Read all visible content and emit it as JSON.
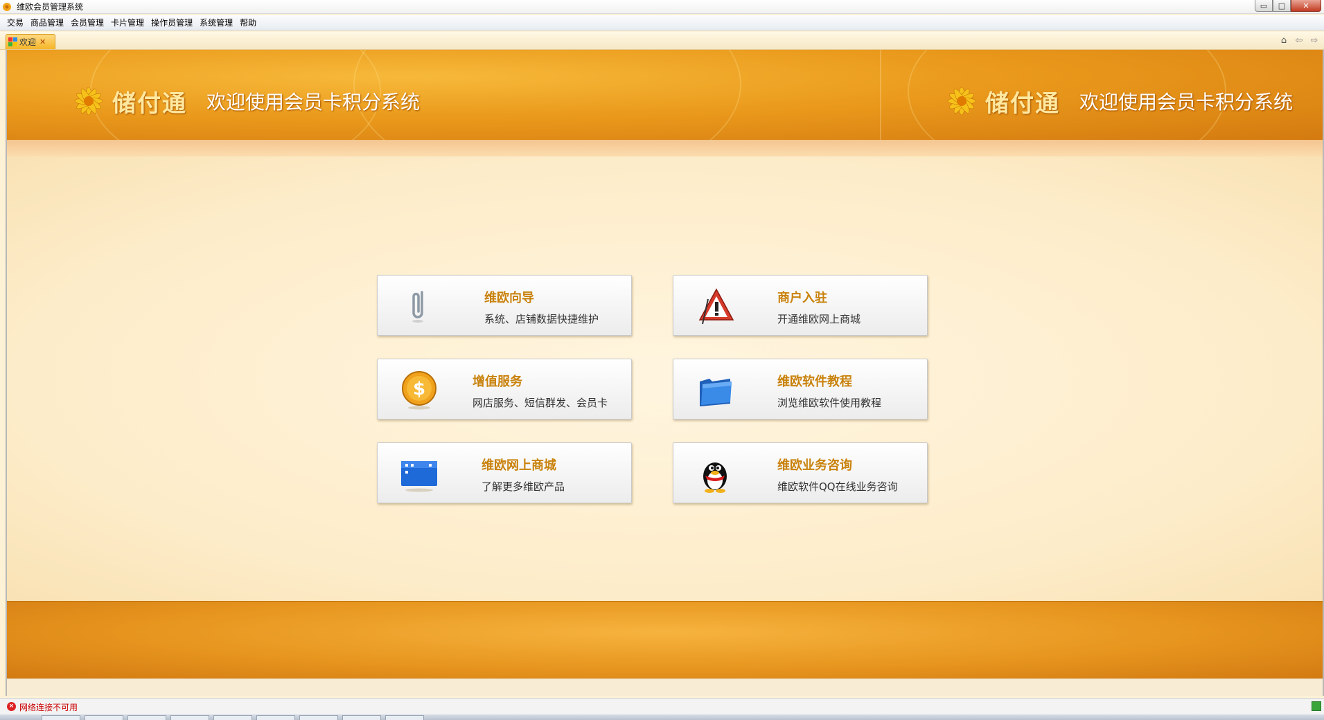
{
  "window": {
    "title": "维欧会员管理系统",
    "buttons": {
      "minimize": "▭",
      "maximize": "□",
      "close": "✕"
    }
  },
  "menubar": {
    "items": [
      "交易",
      "商品管理",
      "会员管理",
      "卡片管理",
      "操作员管理",
      "系统管理",
      "帮助"
    ]
  },
  "tabs": {
    "active_label": "欢迎",
    "close_glyph": "✕",
    "nav": {
      "home": "⌂",
      "back": "⇦",
      "forward": "⇨"
    }
  },
  "banner": {
    "brand": "储付通",
    "welcome": "欢迎使用会员卡积分系统",
    "primary_color": "#ea9a1c"
  },
  "cards": [
    {
      "title": "维欧向导",
      "desc": "系统、店铺数据快捷维护",
      "icon": "paperclip-icon"
    },
    {
      "title": "商户入驻",
      "desc": "开通维欧网上商城",
      "icon": "warning-icon"
    },
    {
      "title": "增值服务",
      "desc": "网店服务、短信群发、会员卡",
      "icon": "dollar-coin-icon"
    },
    {
      "title": "维欧软件教程",
      "desc": "浏览维欧软件使用教程",
      "icon": "folder-icon"
    },
    {
      "title": "维欧网上商城",
      "desc": "了解更多维欧产品",
      "icon": "film-strip-icon"
    },
    {
      "title": "维欧业务咨询",
      "desc": "维欧软件QQ在线业务咨询",
      "icon": "qq-penguin-icon"
    }
  ],
  "status": {
    "text": "网络连接不可用",
    "icon": "error-icon",
    "color": "#cc0000"
  }
}
